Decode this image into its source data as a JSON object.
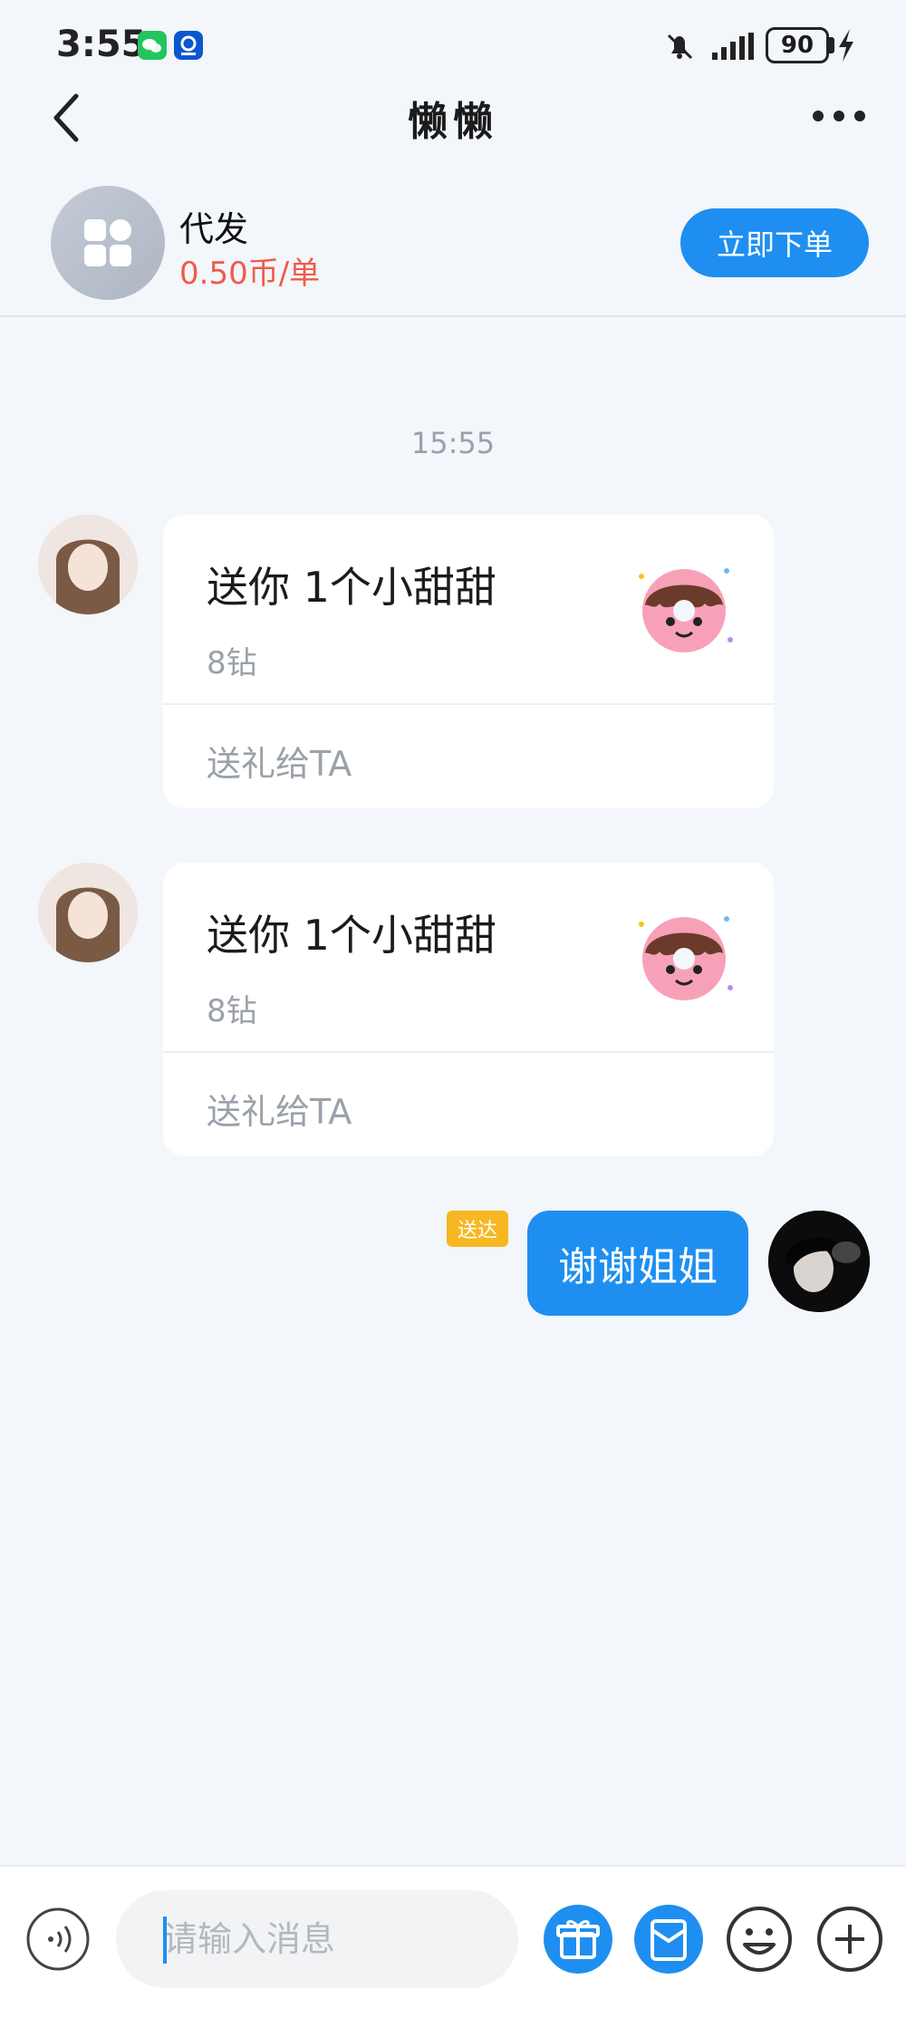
{
  "status_bar": {
    "time": "3:55",
    "battery": "90"
  },
  "header": {
    "title": "懒懒"
  },
  "service": {
    "name": "代发",
    "price": "0.50币/单",
    "order_button": "立即下单"
  },
  "chat": {
    "timestamp": "15:55",
    "gifts": [
      {
        "title": "送你 1个小甜甜",
        "price": "8钻",
        "action": "送礼给TA"
      },
      {
        "title": "送你 1个小甜甜",
        "price": "8钻",
        "action": "送礼给TA"
      }
    ],
    "my_message": {
      "status": "送达",
      "text": "谢谢姐姐"
    }
  },
  "composer": {
    "placeholder": "请输入消息"
  },
  "colors": {
    "accent": "#1e8ff0",
    "price": "#f05a4a",
    "delivered": "#f6b722",
    "background": "#f3f6fa"
  }
}
